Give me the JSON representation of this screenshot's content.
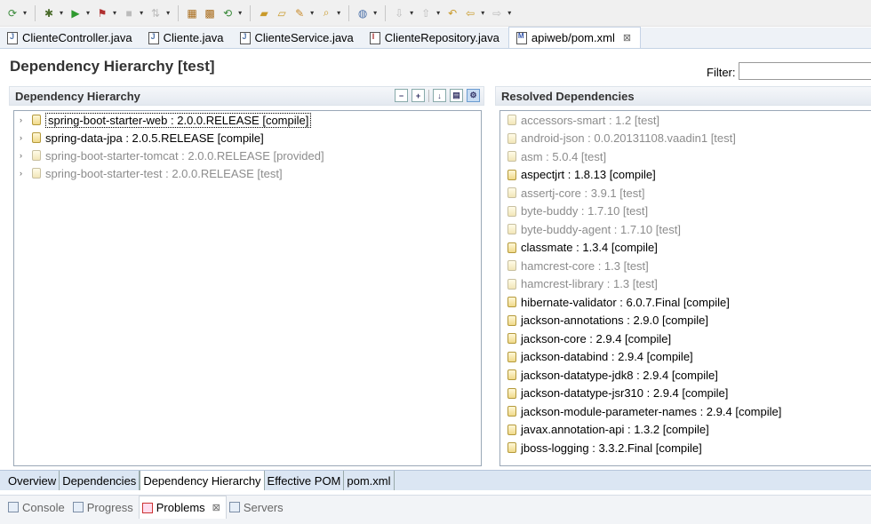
{
  "toolbar": {
    "icons": [
      "new-icon",
      "debug-icon",
      "run-icon",
      "run-config-icon",
      "stop-icon",
      "connect-icon",
      "new-package-icon",
      "new-class-icon",
      "refresh-icon",
      "open-folder-icon",
      "open-file-icon",
      "pen-icon",
      "search-folder-icon",
      "globe-icon",
      "next-annotation-icon",
      "prev-annotation-icon",
      "last-edit-icon",
      "back-icon",
      "forward-icon"
    ]
  },
  "editor_tabs": [
    {
      "label": "ClienteController.java",
      "icon": "java-file-icon",
      "active": false
    },
    {
      "label": "Cliente.java",
      "icon": "java-file-icon",
      "active": false
    },
    {
      "label": "ClienteService.java",
      "icon": "java-file-icon",
      "active": false
    },
    {
      "label": "ClienteRepository.java",
      "icon": "java-interface-icon",
      "active": false
    },
    {
      "label": "apiweb/pom.xml",
      "icon": "maven-pom-icon",
      "active": true,
      "close": "⊠"
    }
  ],
  "page": {
    "title": "Dependency Hierarchy [test]",
    "filter_label": "Filter:",
    "filter_value": ""
  },
  "hierarchy": {
    "header": "Dependency Hierarchy",
    "items": [
      {
        "label": "spring-boot-starter-web : 2.0.0.RELEASE [compile]",
        "dim": false,
        "selected": true
      },
      {
        "label": "spring-data-jpa : 2.0.5.RELEASE [compile]",
        "dim": false,
        "selected": false
      },
      {
        "label": "spring-boot-starter-tomcat : 2.0.0.RELEASE [provided]",
        "dim": true,
        "selected": false
      },
      {
        "label": "spring-boot-starter-test : 2.0.0.RELEASE [test]",
        "dim": true,
        "selected": false
      }
    ]
  },
  "resolved": {
    "header": "Resolved Dependencies",
    "items": [
      {
        "label": "accessors-smart : 1.2 [test]",
        "dim": true
      },
      {
        "label": "android-json : 0.0.20131108.vaadin1 [test]",
        "dim": true
      },
      {
        "label": "asm : 5.0.4 [test]",
        "dim": true
      },
      {
        "label": "aspectjrt : 1.8.13 [compile]",
        "dim": false
      },
      {
        "label": "assertj-core : 3.9.1 [test]",
        "dim": true
      },
      {
        "label": "byte-buddy : 1.7.10 [test]",
        "dim": true
      },
      {
        "label": "byte-buddy-agent : 1.7.10 [test]",
        "dim": true
      },
      {
        "label": "classmate : 1.3.4 [compile]",
        "dim": false
      },
      {
        "label": "hamcrest-core : 1.3 [test]",
        "dim": true
      },
      {
        "label": "hamcrest-library : 1.3 [test]",
        "dim": true
      },
      {
        "label": "hibernate-validator : 6.0.7.Final [compile]",
        "dim": false
      },
      {
        "label": "jackson-annotations : 2.9.0 [compile]",
        "dim": false
      },
      {
        "label": "jackson-core : 2.9.4 [compile]",
        "dim": false
      },
      {
        "label": "jackson-databind : 2.9.4 [compile]",
        "dim": false
      },
      {
        "label": "jackson-datatype-jdk8 : 2.9.4 [compile]",
        "dim": false
      },
      {
        "label": "jackson-datatype-jsr310 : 2.9.4 [compile]",
        "dim": false
      },
      {
        "label": "jackson-module-parameter-names : 2.9.4 [compile]",
        "dim": false
      },
      {
        "label": "javax.annotation-api : 1.3.2 [compile]",
        "dim": false
      },
      {
        "label": "jboss-logging : 3.3.2.Final [compile]",
        "dim": false
      }
    ]
  },
  "page_tabs": [
    {
      "label": "Overview",
      "active": false
    },
    {
      "label": "Dependencies",
      "active": false
    },
    {
      "label": "Dependency Hierarchy",
      "active": true
    },
    {
      "label": "Effective POM",
      "active": false
    },
    {
      "label": "pom.xml",
      "active": false
    }
  ],
  "view_tabs": [
    {
      "label": "Console",
      "active": false
    },
    {
      "label": "Progress",
      "active": false
    },
    {
      "label": "Problems",
      "active": true,
      "close": "⊠"
    },
    {
      "label": "Servers",
      "active": false
    }
  ]
}
